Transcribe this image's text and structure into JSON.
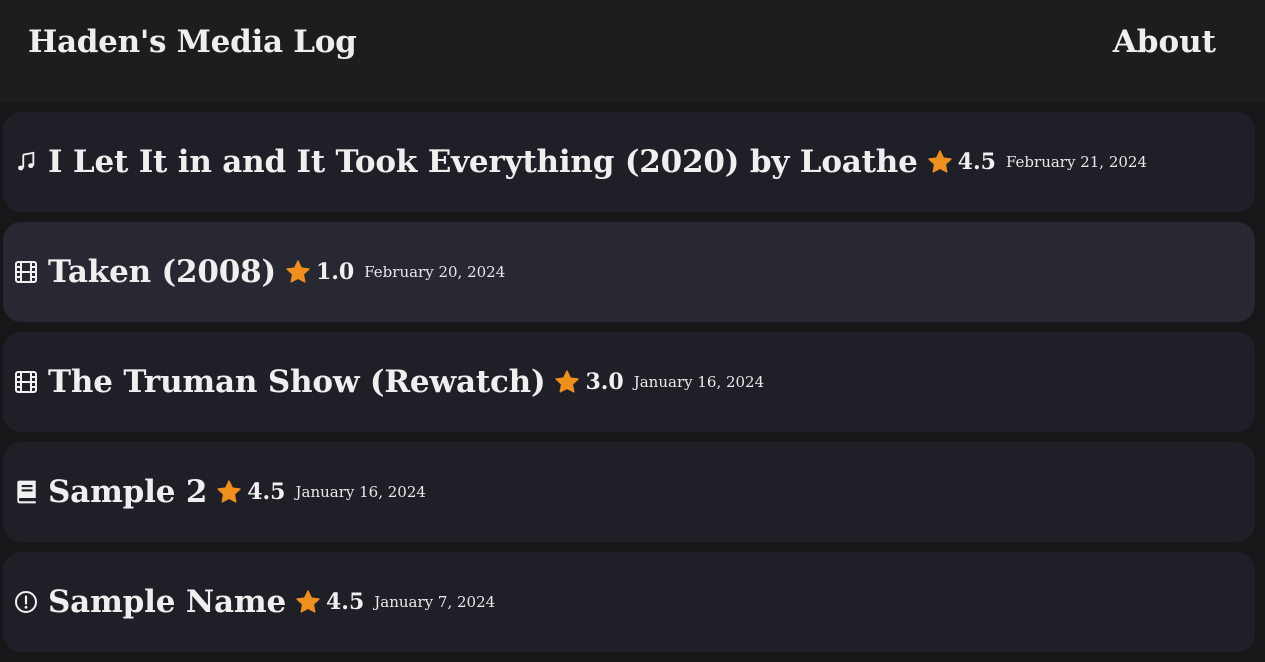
{
  "header": {
    "title": "Haden's Media Log",
    "about_label": "About"
  },
  "colors": {
    "star": "#f0901c",
    "card": "#1f2027",
    "card_hover": "#272831",
    "header_bg": "#1b1d1f",
    "page_bg": "#161719"
  },
  "entries": [
    {
      "icon": "music-note-icon",
      "title": "I Let It in and It Took Everything (2020) by Loathe",
      "rating": "4.5",
      "date": "February 21, 2024"
    },
    {
      "icon": "film-icon",
      "title": "Taken (2008)",
      "rating": "1.0",
      "date": "February 20, 2024"
    },
    {
      "icon": "film-icon",
      "title": "The Truman Show (Rewatch)",
      "rating": "3.0",
      "date": "January 16, 2024"
    },
    {
      "icon": "book-icon",
      "title": "Sample 2",
      "rating": "4.5",
      "date": "January 16, 2024"
    },
    {
      "icon": "alert-circle-icon",
      "title": "Sample Name",
      "rating": "4.5",
      "date": "January 7, 2024"
    }
  ]
}
